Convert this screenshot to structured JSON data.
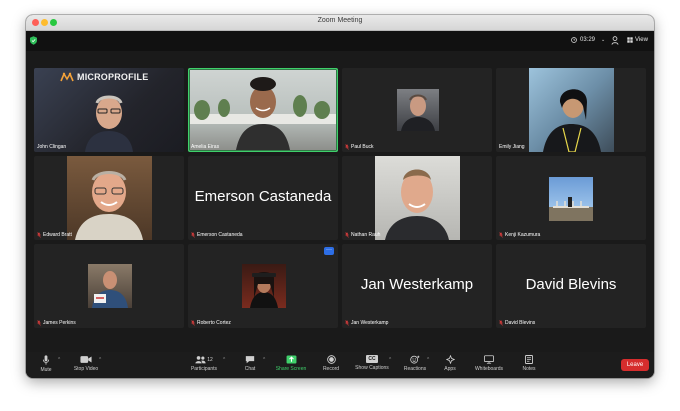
{
  "window": {
    "title": "Zoom Meeting"
  },
  "topbar": {
    "timer": "03:29",
    "view_label": "View"
  },
  "tiles": [
    {
      "name": "John Clingan",
      "logo": "MICROPROFILE",
      "muted": false,
      "active": false
    },
    {
      "name": "Amelia Eiras",
      "muted": false,
      "active": true
    },
    {
      "name": "Paul Buck",
      "muted": true,
      "active": false
    },
    {
      "name": "Emily Jiang",
      "muted": false,
      "active": false
    },
    {
      "name": "Edward Bratt",
      "muted": true,
      "active": false
    },
    {
      "name": "Emerson Castaneda",
      "big_name": "Emerson Castaneda",
      "muted": true,
      "active": false
    },
    {
      "name": "Nathan Rauh",
      "muted": true,
      "active": false
    },
    {
      "name": "Kenji Kazumura",
      "muted": true,
      "active": false
    },
    {
      "name": "James Perkins",
      "muted": true,
      "active": false
    },
    {
      "name": "Roberto Cortez",
      "muted": true,
      "active": false
    },
    {
      "name": "Jan Westerkamp",
      "big_name": "Jan Westerkamp",
      "muted": true,
      "active": false
    },
    {
      "name": "David Blevins",
      "big_name": "David Blevins",
      "muted": true,
      "active": false
    }
  ],
  "more_button": "···",
  "toolbar": {
    "mute": "Mute",
    "stop_video": "Stop Video",
    "participants": "Participants",
    "participants_count": "12",
    "chat": "Chat",
    "share_screen": "Share Screen",
    "record": "Record",
    "show_captions": "Show Captions",
    "cc": "CC",
    "reactions": "Reactions",
    "apps": "Apps",
    "whiteboards": "Whiteboards",
    "notes": "Notes",
    "leave": "Leave"
  },
  "colors": {
    "active_border": "#3fd06b",
    "share_green": "#3fd06b",
    "leave_red": "#d62d2d",
    "more_blue": "#2d6ee6"
  },
  "icons": [
    "shield-icon",
    "clock-icon",
    "person-icon",
    "view-grid-icon",
    "mic-muted-icon",
    "mic-icon",
    "video-icon",
    "participants-icon",
    "chat-icon",
    "share-icon",
    "record-icon",
    "captions-icon",
    "reactions-icon",
    "apps-icon",
    "whiteboard-icon",
    "notes-icon"
  ]
}
